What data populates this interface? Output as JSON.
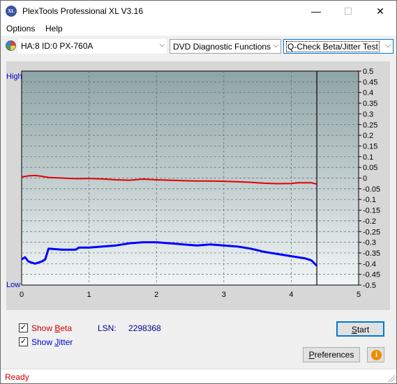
{
  "window": {
    "title": "PlexTools Professional XL V3.16",
    "icon_text": "XL",
    "minimize": "—",
    "maximize": "☐",
    "close": "✕"
  },
  "menu": {
    "items": [
      "Options",
      "Help"
    ]
  },
  "toolbar": {
    "drive": "HA:8 ID:0  PX-760A",
    "function": "DVD Diagnostic Functions",
    "test": "Q-Check Beta/Jitter Test",
    "dropdown_arrow": "⌵"
  },
  "chart": {
    "left_labels": {
      "high": "High",
      "low": "Low"
    },
    "colors": {
      "beta": "#e00000",
      "jitter": "#0000ff",
      "bg_top": "#8fa4a6",
      "bg_bottom": "#f2f5f5"
    }
  },
  "chart_data": {
    "type": "line",
    "x_ticks": [
      "0",
      "1",
      "2",
      "3",
      "4",
      "5"
    ],
    "xlim": [
      0,
      5
    ],
    "y_ticks": [
      "0.5",
      "0.45",
      "0.4",
      "0.35",
      "0.3",
      "0.25",
      "0.2",
      "0.15",
      "0.1",
      "0.05",
      "0",
      "-0.05",
      "-0.1",
      "-0.15",
      "-0.2",
      "-0.25",
      "-0.3",
      "-0.35",
      "-0.4",
      "-0.45",
      "-0.5"
    ],
    "ylim": [
      -0.5,
      0.5
    ],
    "grid": true,
    "end_marker_x": 4.38,
    "series": [
      {
        "x": [
          0.0,
          0.1,
          0.2,
          0.3,
          0.4,
          0.6,
          0.8,
          1.0,
          1.2,
          1.4,
          1.6,
          1.8,
          2.0,
          2.2,
          2.4,
          2.6,
          2.8,
          3.0,
          3.2,
          3.4,
          3.6,
          3.8,
          4.0,
          4.1,
          4.2,
          4.3,
          4.38
        ],
        "y": [
          0.005,
          0.01,
          0.012,
          0.008,
          0.003,
          0.0,
          -0.003,
          -0.002,
          -0.004,
          -0.008,
          -0.01,
          -0.005,
          -0.008,
          -0.01,
          -0.012,
          -0.014,
          -0.014,
          -0.015,
          -0.017,
          -0.02,
          -0.024,
          -0.026,
          -0.025,
          -0.022,
          -0.022,
          -0.022,
          -0.028
        ]
      },
      {
        "x": [
          0.0,
          0.05,
          0.1,
          0.2,
          0.3,
          0.35,
          0.4,
          0.6,
          0.8,
          0.85,
          1.0,
          1.2,
          1.4,
          1.6,
          1.8,
          2.0,
          2.2,
          2.4,
          2.6,
          2.8,
          3.0,
          3.2,
          3.4,
          3.6,
          3.8,
          4.0,
          4.2,
          4.3,
          4.38
        ],
        "y": [
          -0.38,
          -0.37,
          -0.39,
          -0.4,
          -0.39,
          -0.38,
          -0.33,
          -0.335,
          -0.335,
          -0.325,
          -0.325,
          -0.32,
          -0.315,
          -0.305,
          -0.3,
          -0.3,
          -0.305,
          -0.31,
          -0.315,
          -0.31,
          -0.315,
          -0.32,
          -0.33,
          -0.345,
          -0.355,
          -0.365,
          -0.375,
          -0.385,
          -0.41
        ]
      }
    ]
  },
  "controls": {
    "show_beta": {
      "checked": true,
      "mark": "✓",
      "label_pre": "Show ",
      "label_u": "B",
      "label_post": "eta"
    },
    "show_jitter": {
      "checked": true,
      "mark": "✓",
      "label_pre": "Show ",
      "label_u": "J",
      "label_post": "itter"
    },
    "lsn_label": "LSN:",
    "lsn_value": "2298368",
    "start_pre": "",
    "start_u": "S",
    "start_post": "tart",
    "prefs_pre": "",
    "prefs_u": "P",
    "prefs_post": "references",
    "info_icon": "i"
  },
  "status": {
    "text": "Ready"
  }
}
